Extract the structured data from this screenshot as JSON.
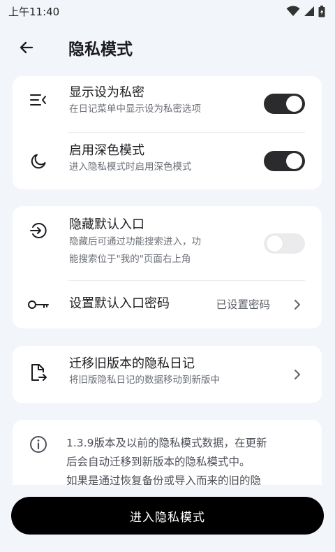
{
  "status_bar": {
    "time": "上午11:40"
  },
  "app_bar": {
    "title": "隐私模式"
  },
  "card1": {
    "items": [
      {
        "title": "显示设为私密",
        "subtitle": "在日记菜单中显示设为私密选项",
        "enabled": true
      },
      {
        "title": "启用深色模式",
        "subtitle": "进入隐私模式时启用深色模式",
        "enabled": true
      }
    ]
  },
  "card2": {
    "hide_entry": {
      "title": "隐藏默认入口",
      "subtitle_line1": "隐藏后可通过功能搜索进入，功",
      "subtitle_line2": "能搜索位于\"我的\"页面右上角",
      "enabled": false
    },
    "password": {
      "title": "设置默认入口密码",
      "value": "已设置密码"
    }
  },
  "card3": {
    "title": "迁移旧版本的隐私日记",
    "subtitle": "将旧版隐私日记的数据移动到新版中"
  },
  "info": {
    "line1": "1.3.9版本及以前的隐私模式数据，在更新",
    "line2": "后会自动迁移到新版本的隐私模式中。",
    "line3": "如果是通过恢复备份或导入而来的旧的隐"
  },
  "primary_button": {
    "label": "进入隐私模式"
  },
  "colors": {
    "background": "#f2f5fa",
    "switch_on": "#2b2b2d",
    "switch_off": "#ebebed",
    "button": "#000000"
  }
}
